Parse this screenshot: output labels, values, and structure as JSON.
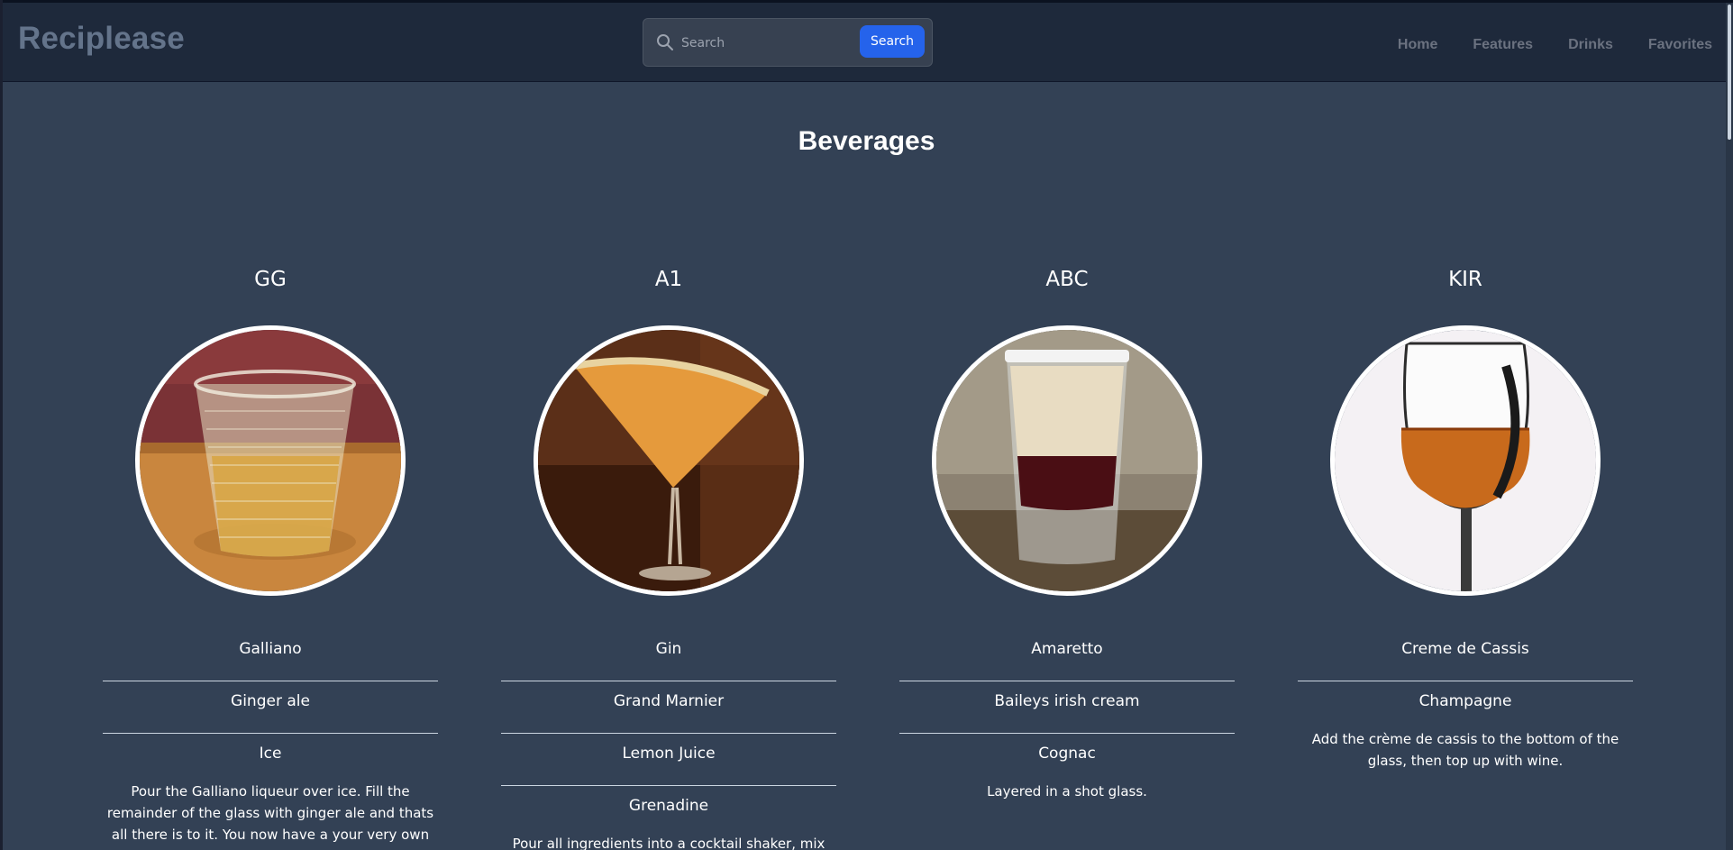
{
  "app": {
    "brand": "Reciplease"
  },
  "search": {
    "placeholder": "Search",
    "button_label": "Search"
  },
  "nav": [
    "Home",
    "Features",
    "Drinks",
    "Favorites"
  ],
  "page": {
    "title": "Beverages"
  },
  "drinks": [
    {
      "name": "GG",
      "image": "glass-of-ginger-ale-on-ice",
      "ingredients": [
        "Galliano",
        "Ginger ale",
        "Ice"
      ],
      "instructions": "Pour the Galliano liqueur over ice. Fill the remainder of the glass with ginger ale and thats all there is to it. You now have a your very own GG."
    },
    {
      "name": "A1",
      "image": "orange-martini-with-sugar-rim",
      "ingredients": [
        "Gin",
        "Grand Marnier",
        "Lemon Juice",
        "Grenadine"
      ],
      "instructions": "Pour all ingredients into a cocktail shaker, mix and"
    },
    {
      "name": "ABC",
      "image": "layered-shot-glass",
      "ingredients": [
        "Amaretto",
        "Baileys irish cream",
        "Cognac"
      ],
      "instructions": "Layered in a shot glass."
    },
    {
      "name": "KIR",
      "image": "wine-glass-with-red-drink",
      "ingredients": [
        "Creme de Cassis",
        "Champagne"
      ],
      "instructions": "Add the crème de cassis to the bottom of the glass, then top up with wine."
    }
  ],
  "colors": {
    "background": "#334155",
    "navbar": "#1e293b",
    "accent": "#2563eb",
    "brand": "#64748b"
  }
}
